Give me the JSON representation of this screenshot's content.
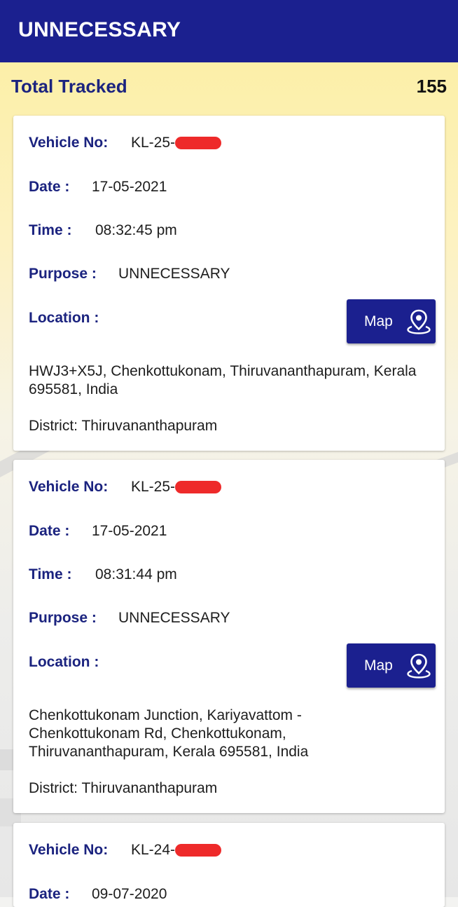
{
  "app_bar": {
    "title": "UNNECESSARY"
  },
  "summary": {
    "label": "Total Tracked",
    "count": "155"
  },
  "labels": {
    "vehicle": "Vehicle No:",
    "date": "Date :",
    "time": "Time :",
    "purpose": "Purpose :",
    "location": "Location :",
    "map_button": "Map"
  },
  "records": [
    {
      "vehicle_no": "KL-25-",
      "date": "17-05-2021",
      "time": "08:32:45 pm",
      "purpose": "UNNECESSARY",
      "address": "HWJ3+X5J, Chenkottukonam, Thiruvananthapuram, Kerala 695581, India",
      "district": "District: Thiruvananthapuram"
    },
    {
      "vehicle_no": "KL-25-",
      "date": "17-05-2021",
      "time": "08:31:44 pm",
      "purpose": "UNNECESSARY",
      "address": "Chenkottukonam Junction, Kariyavattom - Chenkottukonam Rd, Chenkottukonam, Thiruvananthapuram, Kerala 695581, India",
      "district": "District: Thiruvananthapuram"
    },
    {
      "vehicle_no": "KL-24-",
      "date": "09-07-2020"
    }
  ],
  "colors": {
    "app_bar": "#1b208f",
    "label_text": "#1b237f",
    "redaction": "#ee2a2a",
    "background_top": "#fcefa8"
  },
  "icons": {
    "map_button_icon": "location-pin-icon"
  }
}
